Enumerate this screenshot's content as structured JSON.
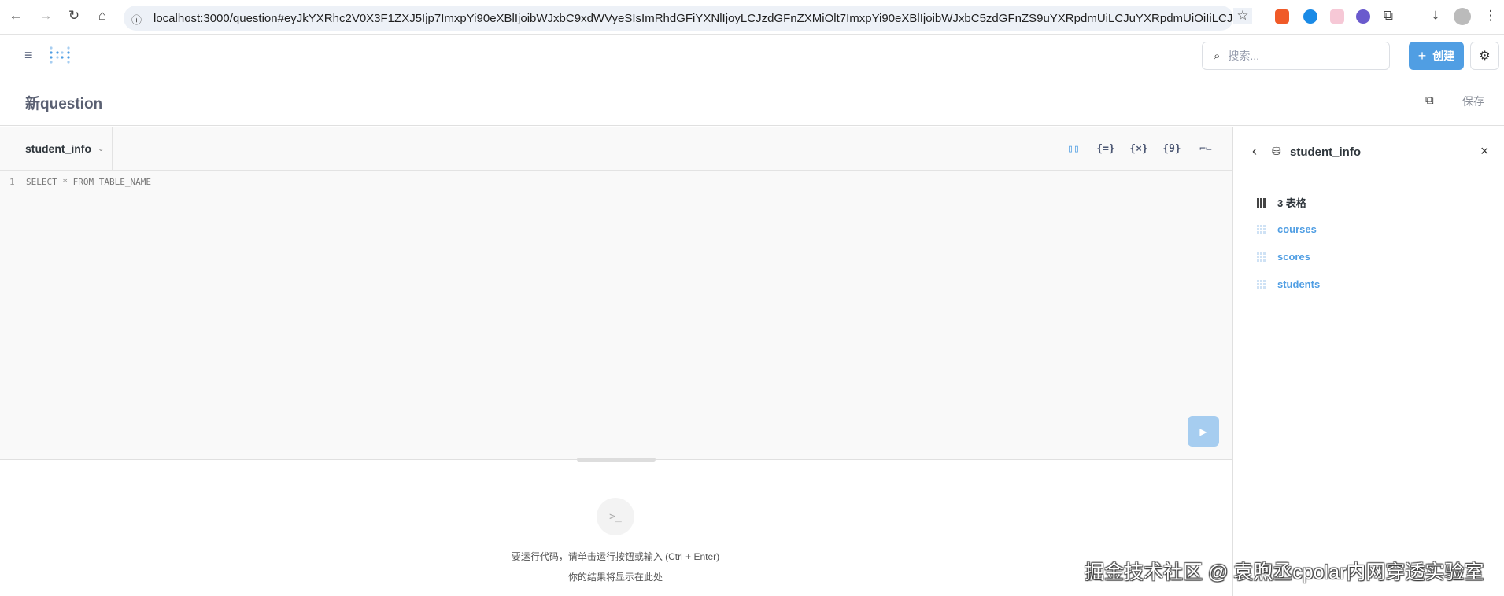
{
  "browser": {
    "url": "localhost:3000/question#eyJkYXRhc2V0X3F1ZXJ5Ijp7ImxpYi90eXBlIjoibWJxbC9xdWVyeSIsImRhdGFiYXNlIjoyLCJzdGFnZXMiOlt7ImxpYi90eXBlIjoibWJxbC5zdGFnZS9uYXRpdmUiLCJuYXRpdmUiOiIiLCJ0Z..."
  },
  "header": {
    "search_placeholder": "搜索...",
    "create_label": "创建"
  },
  "question": {
    "title": "新question",
    "save_label": "保存"
  },
  "editor": {
    "database": "student_info",
    "line_number": "1",
    "code": "SELECT * FROM TABLE_NAME"
  },
  "results": {
    "hint_line1": "要运行代码，请单击运行按钮或输入 (Ctrl + Enter)",
    "hint_line2": "你的结果将显示在此处"
  },
  "sidebar": {
    "database": "student_info",
    "table_count_label": "3 表格",
    "tables": [
      "courses",
      "scores",
      "students"
    ]
  },
  "watermark": "掘金技术社区 @ 袁煦丞cpolar内网穿透实验室",
  "colors": {
    "brand": "#509ee3",
    "run_disabled": "#a6cdf0"
  }
}
